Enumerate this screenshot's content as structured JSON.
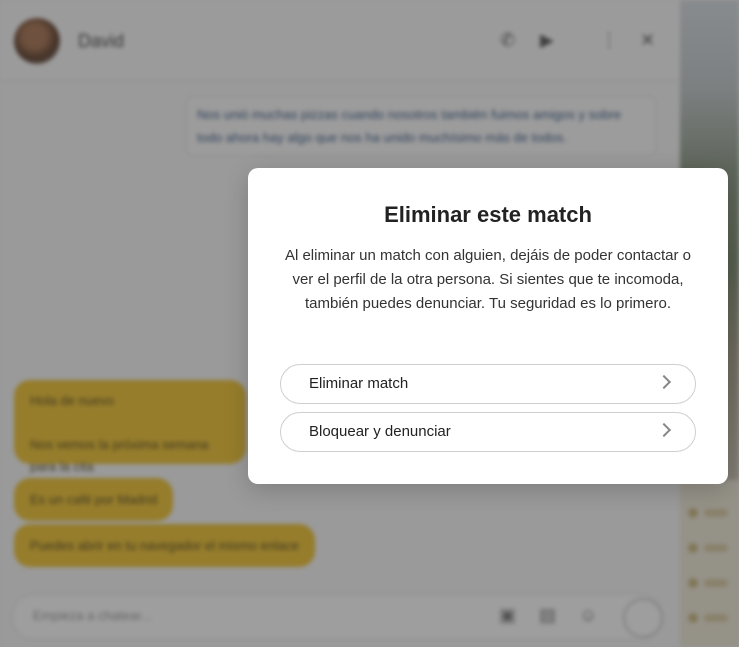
{
  "chat": {
    "contact_name": "David",
    "outgoing_message": "Nos unió muchas pizzas cuando nosotros también fuimos amigos y sobre todo ahora hay algo que nos ha unido muchísimo más de todos.",
    "incoming_messages": [
      "Hola de nuevo\n\nNos vemos la próxima semana para la cita",
      "Es un café por Madrid",
      "Puedes abrir en tu navegador el mismo enlace"
    ],
    "composer_placeholder": "Empieza a chatear..."
  },
  "header_icons": [
    "phone-icon",
    "video-camera-icon",
    "more-vertical-icon",
    "close-icon"
  ],
  "modal": {
    "title": "Eliminar este match",
    "body": "Al eliminar un match con alguien, dejáis de poder contactar o ver el perfil de la otra persona. Si sientes que te incomoda, también puedes denunciar. Tu seguridad es lo primero.",
    "options": [
      {
        "label": "Eliminar match"
      },
      {
        "label": "Bloquear y denunciar"
      }
    ]
  },
  "colors": {
    "accent_yellow": "#f0c330",
    "overlay": "#282828"
  }
}
